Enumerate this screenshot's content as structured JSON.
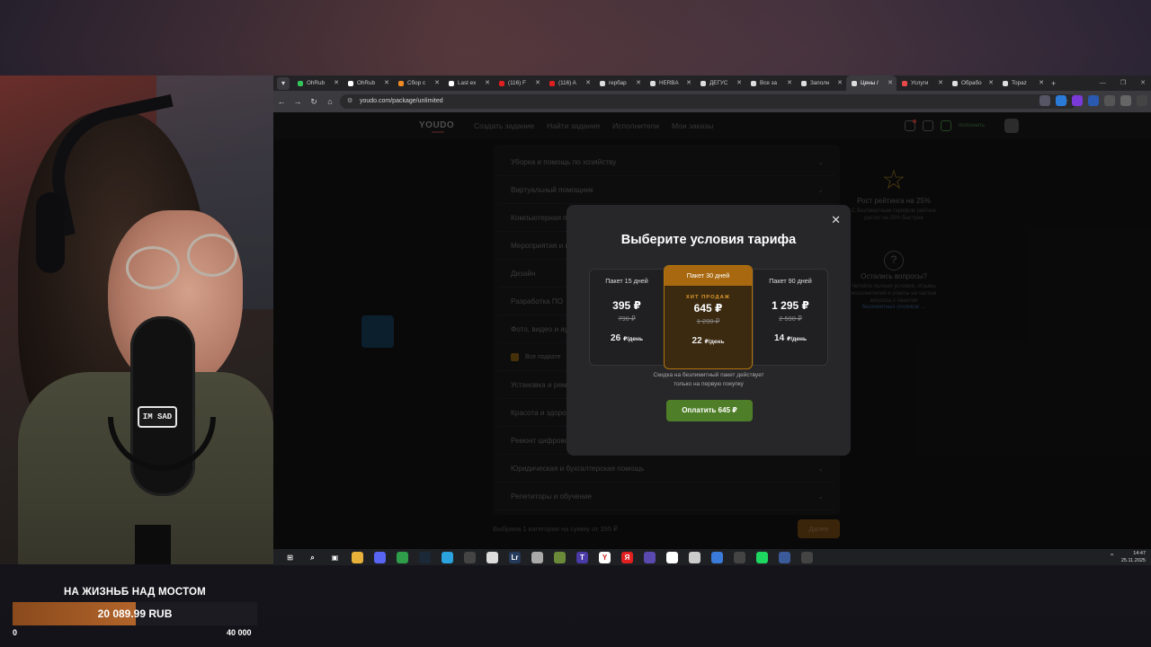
{
  "goal": {
    "title": "НА ЖИЗНЬБ НАД МОСТОМ",
    "amount": "20 089.99 RUB",
    "progress": 0.502,
    "min": "0",
    "max": "40 000"
  },
  "webcam": {
    "mic_sticker": "IM SAD"
  },
  "browser": {
    "tabs": [
      {
        "label": "OhRub",
        "color": "#35c45a"
      },
      {
        "label": "OhRub",
        "color": "#ffffff"
      },
      {
        "label": "Сбор с",
        "color": "#f08a24"
      },
      {
        "label": "Last ex",
        "color": "#ffffff"
      },
      {
        "label": "(116) F",
        "color": "#e02020"
      },
      {
        "label": "(116) A",
        "color": "#e02020"
      },
      {
        "label": "гербар",
        "color": "#dddddd"
      },
      {
        "label": "HERBA",
        "color": "#dddddd"
      },
      {
        "label": "ДЕГУС",
        "color": "#dddddd"
      },
      {
        "label": "Все за",
        "color": "#dddddd"
      },
      {
        "label": "Заполн",
        "color": "#dddddd"
      },
      {
        "label": "Цены /",
        "color": "#dddddd"
      },
      {
        "label": "Услуги",
        "color": "#e84a4a"
      },
      {
        "label": "Обрабо",
        "color": "#dddddd"
      },
      {
        "label": "Topaz",
        "color": "#dddddd"
      }
    ],
    "active_tab": 11,
    "url": "youdo.com/package/unlimited"
  },
  "youdo": {
    "logo": "YOUDO",
    "nav": [
      "Создать задание",
      "Найти задания",
      "Исполнители",
      "Мои заказы"
    ],
    "replenish": "пополнить",
    "categories": [
      "Уборка и помощь по хозяйству",
      "Виртуальный помощник",
      "Компьютерная п",
      "Мероприятия и п",
      "Дизайн",
      "Разработка ПО",
      "Фото, видео и ау",
      "Все подкате",
      "Установка и рем",
      "Красота и здоро",
      "Ремонт цифрово",
      "Юридическая и бухгалтерская помощь",
      "Репетиторы и обучение"
    ],
    "side": {
      "rating_title": "Рост рейтинга на 25%",
      "rating_text": "С безлимитным тарифом рейтинг растет на 25% быстрее",
      "questions_title": "Остались вопросы?",
      "questions_text": "Читайте полные условия, отзывы исполнителей и ответы на частые вопросы с пакетом",
      "questions_link": "безлимитных откликов →"
    },
    "bottom_text": "Выбрана 1 категория на сумму от 395 ₽",
    "next_label": "Далее"
  },
  "modal": {
    "title": "Выберите условия тарифа",
    "plans": [
      {
        "name": "Пакет 15 дней",
        "price": "395 ₽",
        "old": "790 ₽",
        "per_day": "26",
        "per_day_unit": "₽/день"
      },
      {
        "name": "Пакет 30 дней",
        "badge": "ХИТ ПРОДАЖ",
        "price": "645 ₽",
        "old": "1 290 ₽",
        "per_day": "22",
        "per_day_unit": "₽/день"
      },
      {
        "name": "Пакет 90 дней",
        "price": "1 295 ₽",
        "old": "2 590 ₽",
        "per_day": "14",
        "per_day_unit": "₽/день"
      }
    ],
    "note_line1": "Скидка на безлимитный пакет действует",
    "note_line2": "только на первую покупку",
    "pay_label": "Оплатить 645 ₽"
  },
  "taskbar": {
    "icons": [
      {
        "name": "windows-icon",
        "glyph": "⊞",
        "color": "#1f2023"
      },
      {
        "name": "search-icon",
        "glyph": "⌕",
        "color": "#1f2023"
      },
      {
        "name": "task-view-icon",
        "glyph": "▣",
        "color": "#1f2023"
      },
      {
        "name": "file-explorer-icon",
        "glyph": "",
        "color": "#e8b23a"
      },
      {
        "name": "discord-icon",
        "glyph": "",
        "color": "#5865f2"
      },
      {
        "name": "chrome-icon",
        "glyph": "",
        "color": "#2f9e4a"
      },
      {
        "name": "steam-icon",
        "glyph": "",
        "color": "#1b2838"
      },
      {
        "name": "telegram-icon",
        "glyph": "",
        "color": "#2aa3df"
      },
      {
        "name": "obs-icon",
        "glyph": "",
        "color": "#444444"
      },
      {
        "name": "file-icon",
        "glyph": "",
        "color": "#dddddd"
      },
      {
        "name": "lrc-icon",
        "glyph": "Lr",
        "color": "#243a5a"
      },
      {
        "name": "app-icon",
        "glyph": "",
        "color": "#aaaaaa"
      },
      {
        "name": "app2-icon",
        "glyph": "",
        "color": "#6a8a3a"
      },
      {
        "name": "t-icon",
        "glyph": "T",
        "color": "#4a3aa8"
      },
      {
        "name": "yandex-browser-icon",
        "glyph": "Y",
        "color": "#ffffff"
      },
      {
        "name": "yandex-icon",
        "glyph": "Я",
        "color": "#e02020"
      },
      {
        "name": "app3-icon",
        "glyph": "",
        "color": "#5a4ab0"
      },
      {
        "name": "notepad-icon",
        "glyph": "",
        "color": "#ffffff"
      },
      {
        "name": "app4-icon",
        "glyph": "",
        "color": "#cccccc"
      },
      {
        "name": "stats-icon",
        "glyph": "",
        "color": "#3a7ad8"
      },
      {
        "name": "app5-icon",
        "glyph": "",
        "color": "#444444"
      },
      {
        "name": "spotify-icon",
        "glyph": "",
        "color": "#1ed760"
      },
      {
        "name": "app6-icon",
        "glyph": "",
        "color": "#3a5a9a"
      },
      {
        "name": "calculator-icon",
        "glyph": "",
        "color": "#444444"
      }
    ],
    "time": "14:47",
    "date": "25.11.2025"
  }
}
